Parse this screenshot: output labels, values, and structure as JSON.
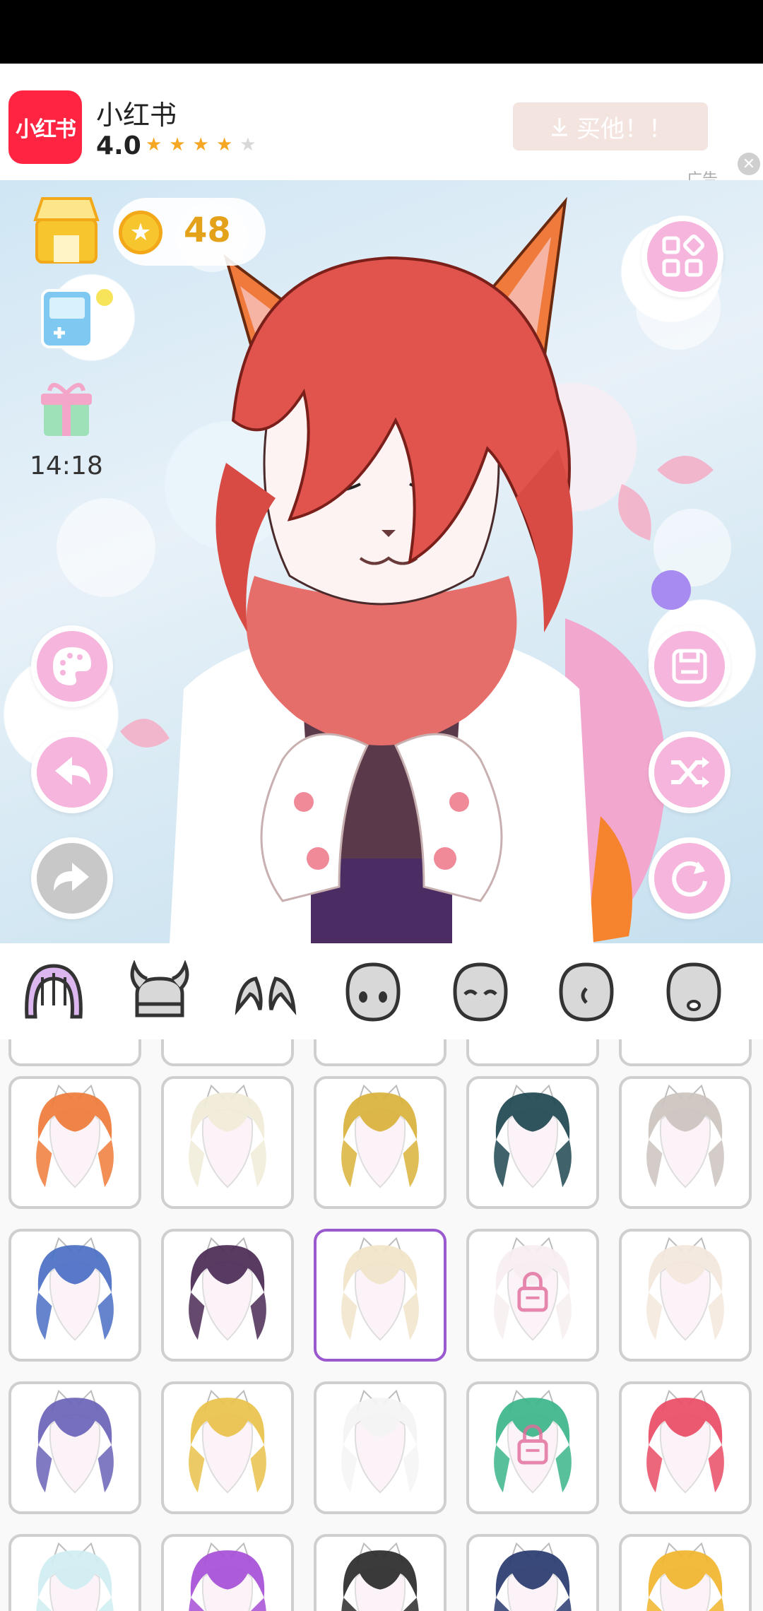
{
  "ad": {
    "app_name": "小红书",
    "logo_text": "小红书",
    "rating": "4.0",
    "stars_filled": 4,
    "stars_total": 5,
    "button_label": "买他！！",
    "label": "广告"
  },
  "hud": {
    "coins": "48",
    "timer": "14:18"
  },
  "tabs": [
    {
      "icon": "hair-icon",
      "selected": true
    },
    {
      "icon": "horns-helmet-icon",
      "selected": false
    },
    {
      "icon": "ears-icon",
      "selected": false
    },
    {
      "icon": "face-eyes-icon",
      "selected": false
    },
    {
      "icon": "face-closed-eyes-icon",
      "selected": false
    },
    {
      "icon": "face-profile-icon",
      "selected": false
    },
    {
      "icon": "face-mouth-icon",
      "selected": false
    }
  ],
  "grid": {
    "items": [
      {
        "color": "#ee7b3a",
        "locked": false,
        "selected": false
      },
      {
        "color": "#f1ecd8",
        "locked": false,
        "selected": false
      },
      {
        "color": "#d9b13a",
        "locked": false,
        "selected": false
      },
      {
        "color": "#1e4650",
        "locked": false,
        "selected": false
      },
      {
        "color": "#cbc3be",
        "locked": false,
        "selected": false
      },
      {
        "color": "#4a6fc4",
        "locked": false,
        "selected": false
      },
      {
        "color": "#4b2a55",
        "locked": false,
        "selected": false
      },
      {
        "color": "#f1e4c9",
        "locked": false,
        "selected": true
      },
      {
        "color": "#f6eef0",
        "locked": true,
        "selected": false
      },
      {
        "color": "#f3e7dc",
        "locked": false,
        "selected": false
      },
      {
        "color": "#6a63b8",
        "locked": false,
        "selected": false
      },
      {
        "color": "#e9c14a",
        "locked": false,
        "selected": false
      },
      {
        "color": "#f4f4f4",
        "locked": false,
        "selected": false
      },
      {
        "color": "#3bb58a",
        "locked": true,
        "selected": false
      },
      {
        "color": "#e94c64",
        "locked": false,
        "selected": false
      },
      {
        "color": "#cfeef2",
        "locked": false,
        "selected": false
      },
      {
        "color": "#a64fd6",
        "locked": false,
        "selected": false
      },
      {
        "color": "#2a2a2a",
        "locked": false,
        "selected": false
      },
      {
        "color": "#283a6e",
        "locked": false,
        "selected": false
      },
      {
        "color": "#f1b52c",
        "locked": false,
        "selected": false
      }
    ]
  },
  "colors": {
    "accent_pink": "#f6b5dd",
    "selected_border": "#9b59d0",
    "coin": "#e3a21a",
    "brand_red": "#ff2442"
  }
}
